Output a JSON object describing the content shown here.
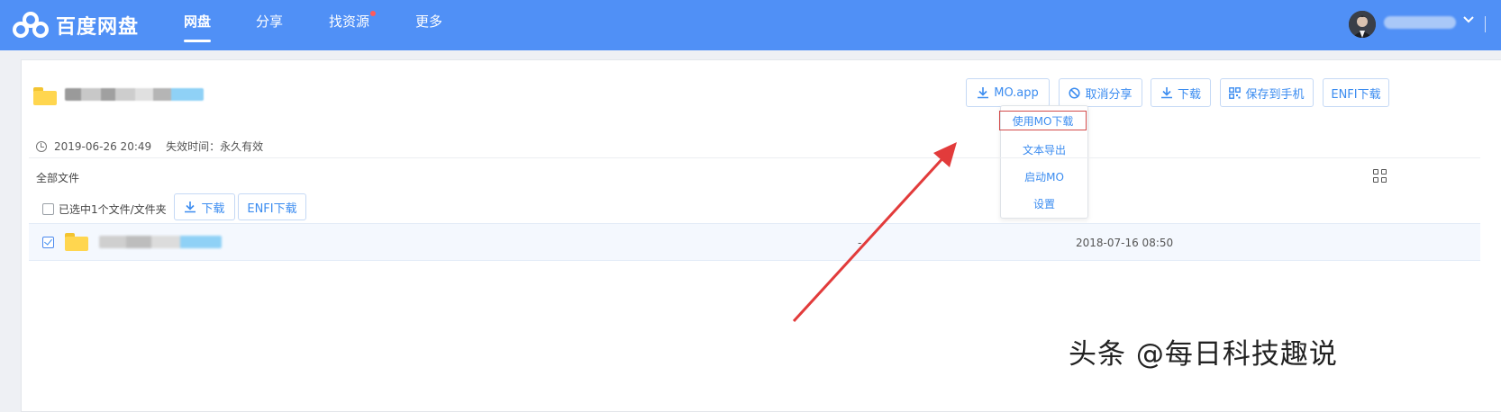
{
  "app": {
    "title": "百度网盘",
    "brand_color": "#5090f6"
  },
  "nav": {
    "items": [
      {
        "label": "网盘",
        "active": true
      },
      {
        "label": "分享"
      },
      {
        "label": "找资源",
        "badge": "red-dot"
      },
      {
        "label": "更多"
      }
    ]
  },
  "user": {
    "avatar_icon": "user-avatar",
    "menu_icon": "chevron-down-icon"
  },
  "share": {
    "date": "2019-06-26 20:49",
    "expire_label": "失效时间：",
    "expire_value": "永久有效"
  },
  "toolbar": {
    "mo_app": "MO.app",
    "cancel_share": "取消分享",
    "download": "下载",
    "save_to_phone": "保存到手机",
    "enfi_download": "ENFI下载"
  },
  "dropdown": {
    "items": [
      "使用MO下载",
      "文本导出",
      "启动MO",
      "设置"
    ],
    "highlighted": "使用MO下载"
  },
  "files": {
    "breadcrumb": "全部文件",
    "selection_label": "已选中1个文件/文件夹",
    "download": "下载",
    "enfi_download": "ENFI下载",
    "rows": [
      {
        "size": "-",
        "date": "2018-07-16 08:50",
        "checked": true
      }
    ]
  },
  "watermark": "头条 @每日科技趣说",
  "colors": {
    "link_blue": "#3b8cf0",
    "annotation_red": "#e23b3b",
    "folder_yellow": "#ffd64f"
  }
}
